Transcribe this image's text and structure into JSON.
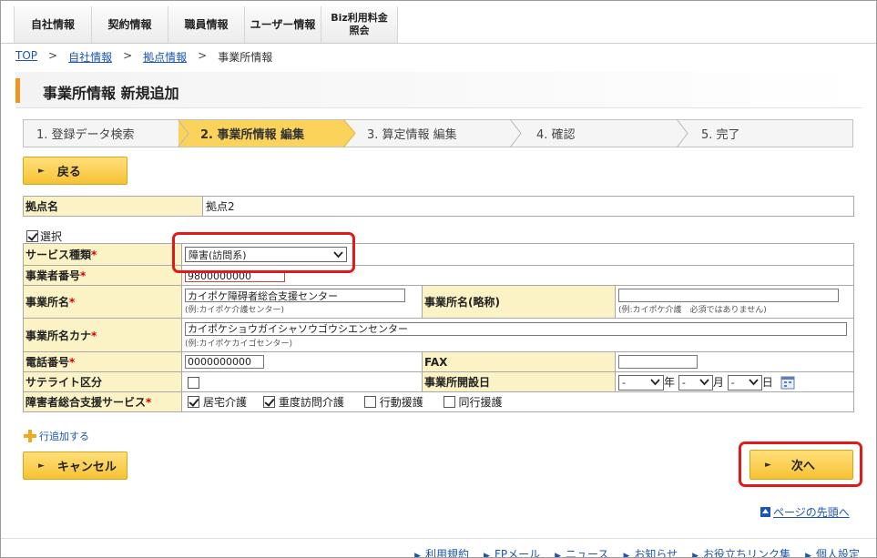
{
  "nav": {
    "tabs": [
      "自社情報",
      "契約情報",
      "職員情報",
      "ユーザー情報",
      "Biz利用料金\n照会"
    ]
  },
  "breadcrumb": {
    "top": "TOP",
    "company": "自社情報",
    "bases": "拠点情報",
    "current": "事業所情報",
    "sep": ">"
  },
  "page": {
    "title": "事業所情報 新規追加"
  },
  "steps": [
    {
      "label": "1. 登録データ検索",
      "active": false
    },
    {
      "label": "2. 事業所情報 編集",
      "active": true
    },
    {
      "label": "3. 算定情報 編集",
      "active": false
    },
    {
      "label": "4. 確認",
      "active": false
    },
    {
      "label": "5. 完了",
      "active": false
    }
  ],
  "buttons": {
    "back": "戻る",
    "cancel": "キャンセル",
    "next": "次へ",
    "add_row": "行追加する",
    "page_top": "ページの先頭へ"
  },
  "base": {
    "label": "拠点名",
    "value": "拠点2"
  },
  "select_label": "選択",
  "form": {
    "service_type": {
      "label": "サービス種類",
      "value": "障害(訪問系)"
    },
    "operator_no": {
      "label": "事業者番号",
      "value": "9800000000"
    },
    "office_name": {
      "label": "事業所名",
      "value": "カイポケ障碍者総合支援センター",
      "hint": "(例:カイポケ介護センター)"
    },
    "office_short": {
      "label": "事業所名(略称)",
      "value": "",
      "hint": "(例:カイポケ介護　必須ではありません)"
    },
    "office_kana": {
      "label": "事業所名カナ",
      "value": "カイポケショウガイシャソウゴウシエンセンター",
      "hint": "(例:カイポケカイゴセンター)"
    },
    "phone": {
      "label": "電話番号",
      "value": "0000000000"
    },
    "fax": {
      "label": "FAX",
      "value": ""
    },
    "satellite": {
      "label": "サテライト区分"
    },
    "open_date": {
      "label": "事業所開設日",
      "year": "-",
      "month": "-",
      "day": "-",
      "y": "年",
      "m": "月",
      "d": "日"
    },
    "services": {
      "label": "障害者総合支援サービス",
      "items": [
        {
          "label": "居宅介護",
          "checked": true
        },
        {
          "label": "重度訪問介護",
          "checked": true
        },
        {
          "label": "行動援護",
          "checked": false
        },
        {
          "label": "同行援護",
          "checked": false
        }
      ]
    }
  },
  "required_mark": "*",
  "footer": {
    "links": [
      "利用規約",
      "FPメール",
      "ニュース",
      "お知らせ",
      "お役立ちリンク集",
      "個人設定"
    ]
  },
  "colors": {
    "accent": "#f0961c",
    "label_bg": "#fbf3c6",
    "button": "#f6c233",
    "highlight": "#e01a1a",
    "link": "#1a55b8"
  }
}
